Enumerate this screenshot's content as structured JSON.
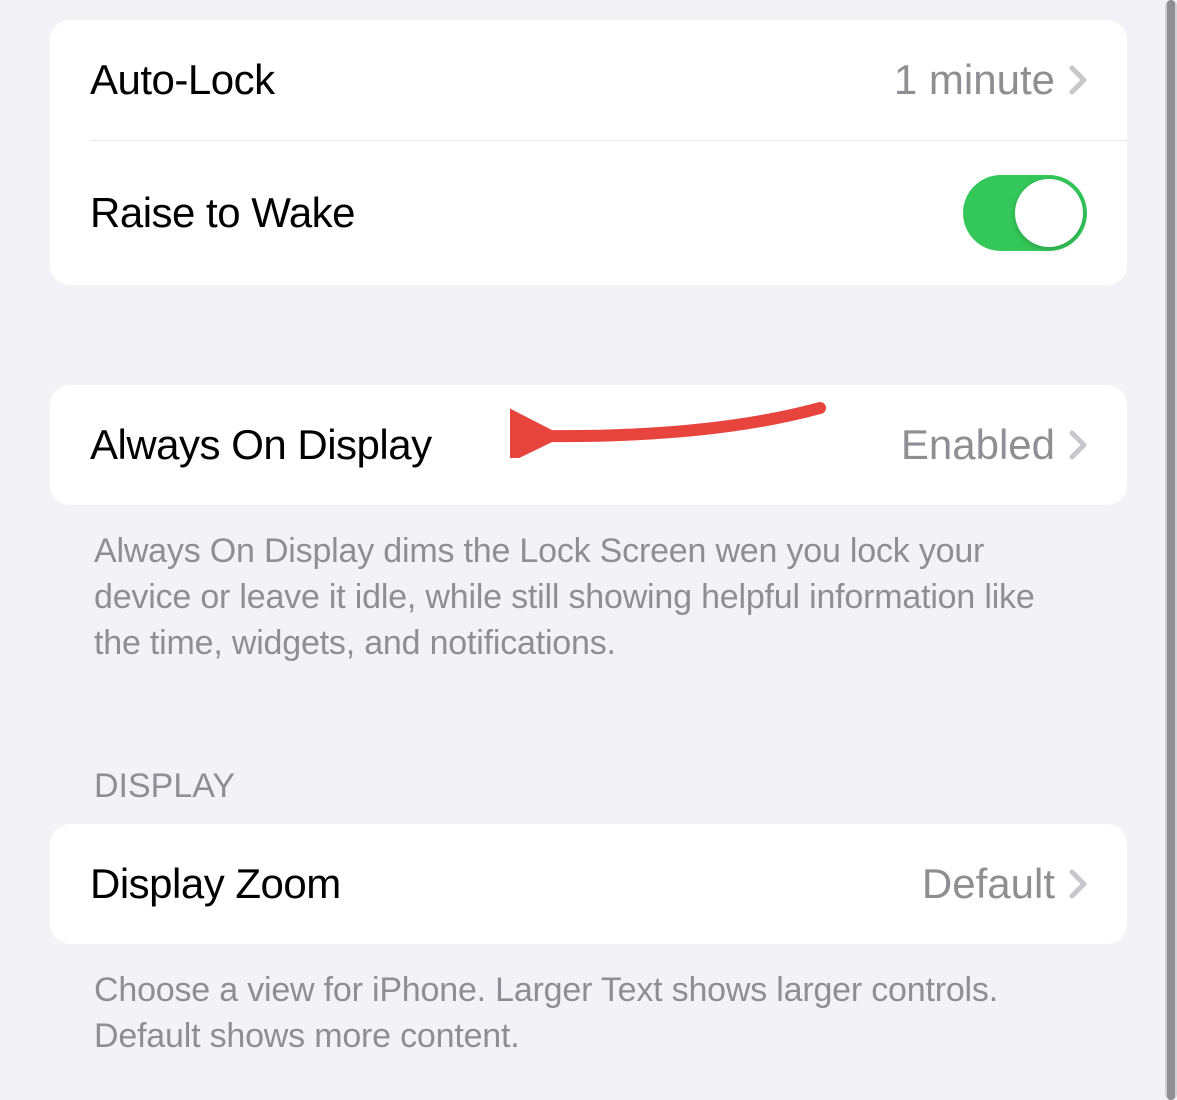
{
  "group1": {
    "autoLock": {
      "label": "Auto-Lock",
      "value": "1 minute"
    },
    "raiseToWake": {
      "label": "Raise to Wake",
      "enabled": true
    }
  },
  "group2": {
    "alwaysOnDisplay": {
      "label": "Always On Display",
      "value": "Enabled"
    },
    "footer": "Always On Display dims the Lock Screen wen you lock your device or leave it idle, while still showing helpful information like the time, widgets, and notifications."
  },
  "group3": {
    "header": "DISPLAY",
    "displayZoom": {
      "label": "Display Zoom",
      "value": "Default"
    },
    "footer": "Choose a view for iPhone. Larger Text shows larger controls. Default shows more content."
  },
  "colors": {
    "toggleOn": "#34c759",
    "annotationArrow": "#e8443e"
  }
}
